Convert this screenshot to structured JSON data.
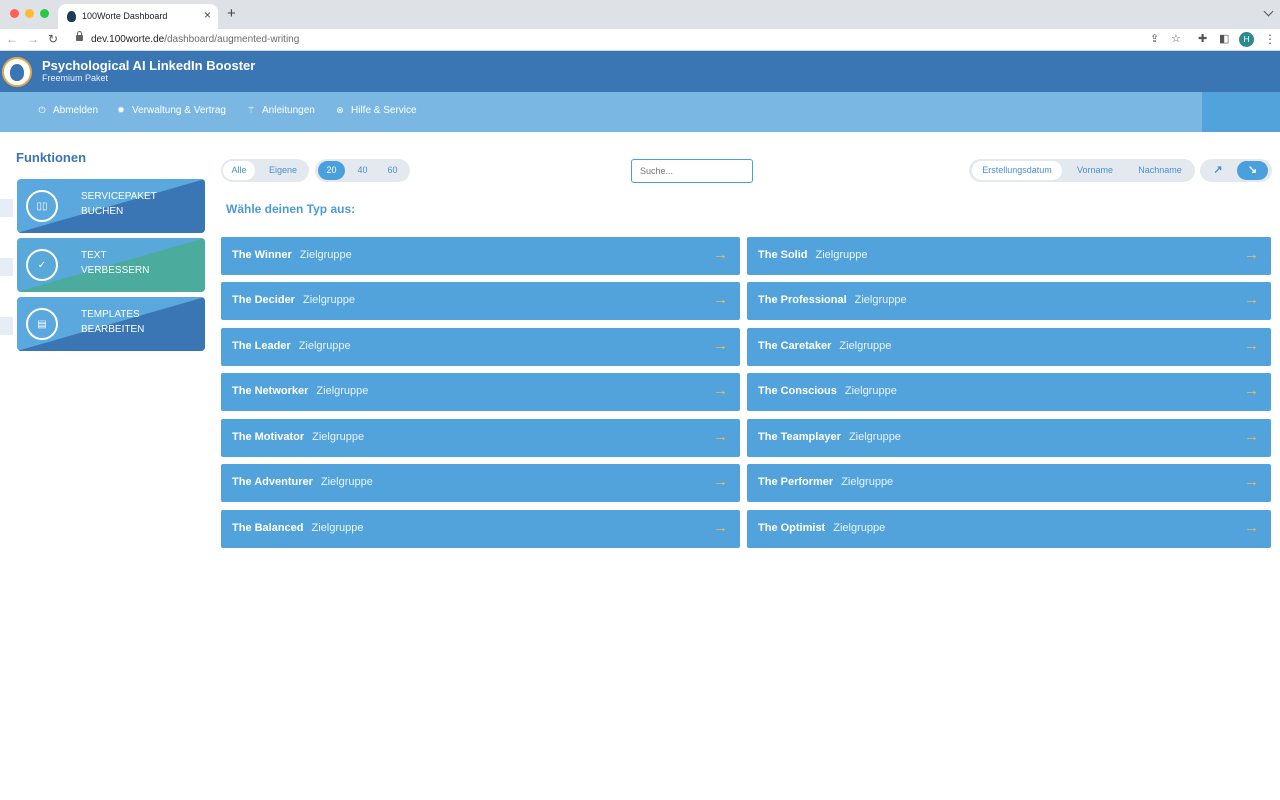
{
  "browser": {
    "tab_title": "100Worte Dashboard",
    "url_domain": "dev.100worte.de",
    "url_path": "/dashboard/augmented-writing",
    "avatar_letter": "H"
  },
  "app": {
    "title": "Psychological AI LinkedIn Booster",
    "subtitle": "Freemium Paket"
  },
  "nav": [
    {
      "label": "Abmelden",
      "icon": "power-icon"
    },
    {
      "label": "Verwaltung & Vertrag",
      "icon": "gear-icon"
    },
    {
      "label": "Anleitungen",
      "icon": "wand-icon"
    },
    {
      "label": "Hilfe & Service",
      "icon": "lifebuoy-icon"
    }
  ],
  "sidebar": {
    "title": "Funktionen",
    "cards": [
      {
        "line1": "SERVICEPAKET",
        "line2": "BUCHEN",
        "icon": "package-icon",
        "color_a": "#5aa8dd",
        "color_b": "#3a76b4"
      },
      {
        "line1": "TEXT",
        "line2": "VERBESSERN",
        "icon": "check-badge-icon",
        "color_a": "#58a9da",
        "color_b": "#4bab9c"
      },
      {
        "line1": "TEMPLATES",
        "line2": "BEARBEITEN",
        "icon": "template-icon",
        "color_a": "#5aa8dd",
        "color_b": "#3a76b4"
      }
    ]
  },
  "toolbar": {
    "filter": [
      "Alle",
      "Eigene"
    ],
    "filter_selected": "Alle",
    "page_sizes": [
      "20",
      "40",
      "60"
    ],
    "page_size_selected": "20",
    "search_placeholder": "Suche...",
    "sort_fields": [
      "Erstellungsdatum",
      "Vorname",
      "Nachname"
    ],
    "sort_selected": "Erstellungsdatum",
    "sort_dir": [
      "ascending-arrow-icon",
      "descending-arrow-icon"
    ],
    "sort_dir_selected": "descending-arrow-icon"
  },
  "section_title": "Wähle deinen Typ aus:",
  "types": {
    "group_label": "Zielgruppe",
    "left": [
      "The Winner",
      "The Decider",
      "The Leader",
      "The Networker",
      "The Motivator",
      "The Adventurer",
      "The Balanced"
    ],
    "right": [
      "The Solid",
      "The Professional",
      "The Caretaker",
      "The Conscious",
      "The Teamplayer",
      "The Performer",
      "The Optimist"
    ]
  }
}
